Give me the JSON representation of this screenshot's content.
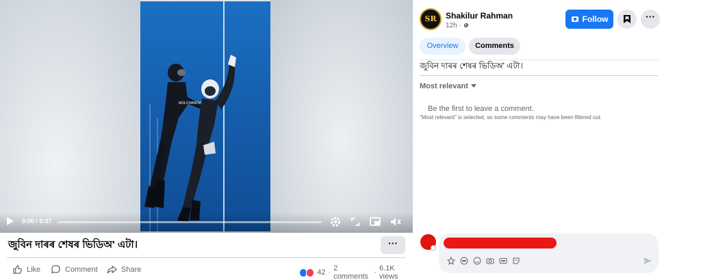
{
  "video": {
    "time": "0:00 / 0:37",
    "progress": 0.0,
    "watermark": "MOLCHANOVS"
  },
  "caption": "জুবিন দাৰৰ শেষৰ ভিডিঅ' এটা।",
  "more_label": "···",
  "actions": {
    "like": "Like",
    "comment": "Comment",
    "share": "Share"
  },
  "stats": {
    "reactions": "42",
    "comments": "2 comments",
    "views": "6.1K views",
    "separator": "·"
  },
  "panel": {
    "avatar_text": "SR",
    "author": "Shakilur Rahman",
    "time": "12h · ",
    "follow_label": "Follow",
    "options_label": "···",
    "tabs": {
      "overview": "Overview",
      "comments": "Comments"
    },
    "post_text": "জুবিন দাৰৰ শেষৰ ভিডিঅ' এটা।",
    "sort_label": "Most relevant",
    "empty_title": "Be the first to leave a comment.",
    "empty_sub": "\"Most relevant\" is selected, so some comments may have been filtered out."
  },
  "colors": {
    "accent": "#1877f2",
    "redaction": "#ea1714",
    "like_blue": "#1877f2",
    "love_red": "#f33e58"
  },
  "icons": [
    "play-icon",
    "settings-icon",
    "fullscreen-icon",
    "pip-icon",
    "volume-icon",
    "like-icon",
    "comment-icon",
    "share-icon",
    "follow-icon",
    "save-icon",
    "sticker-icon",
    "avatar-icon",
    "emoji-icon",
    "camera-icon",
    "gif-icon",
    "face-sticker-icon",
    "send-icon",
    "globe-icon",
    "chevron-down-icon"
  ]
}
